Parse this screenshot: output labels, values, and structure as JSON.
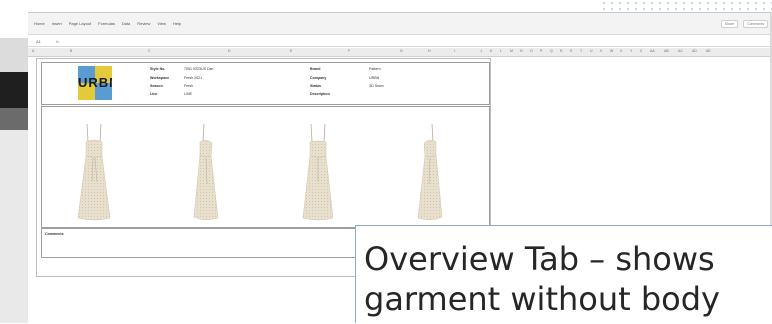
{
  "app": {
    "menu": [
      "Home",
      "Insert",
      "Page Layout",
      "Formulas",
      "Data",
      "Review",
      "View",
      "Help"
    ],
    "menu_right": [
      "Share",
      "Comments"
    ],
    "formula_bar": {
      "cell_ref": "A1",
      "fx": "fx"
    },
    "columns": [
      "A",
      "B",
      "C",
      "D",
      "E",
      "F",
      "G",
      "H",
      "I",
      "J",
      "K",
      "L",
      "M",
      "N",
      "O",
      "P",
      "Q",
      "R",
      "S",
      "T",
      "U",
      "V",
      "W",
      "X",
      "Y",
      "Z",
      "AA",
      "AB",
      "AC",
      "AD",
      "AE"
    ]
  },
  "sheet": {
    "logo_text": "URBN",
    "fields_left": [
      {
        "label": "Style No.",
        "value": "7051 9323US Dsn"
      },
      {
        "label": "Workspace",
        "value": "Fresh 2021"
      },
      {
        "label": "Season",
        "value": "Fresh"
      },
      {
        "label": "Line",
        "value": "LINE"
      }
    ],
    "fields_right": [
      {
        "label": "Brand",
        "value": "Pattern"
      },
      {
        "label": "Company",
        "value": "URBN"
      },
      {
        "label": "Status",
        "value": "3D Sewn"
      },
      {
        "label": "Description",
        "value": ""
      }
    ],
    "comments_label": "Comments"
  },
  "caption": {
    "line1": "Overview Tab – shows",
    "line2": "garment without body"
  },
  "colors": {
    "logo_yellow": "#e4c93a",
    "logo_blue": "#5a9bd1",
    "dress_fabric": "#e8dfcc",
    "caption_border": "#8fa9c9"
  }
}
